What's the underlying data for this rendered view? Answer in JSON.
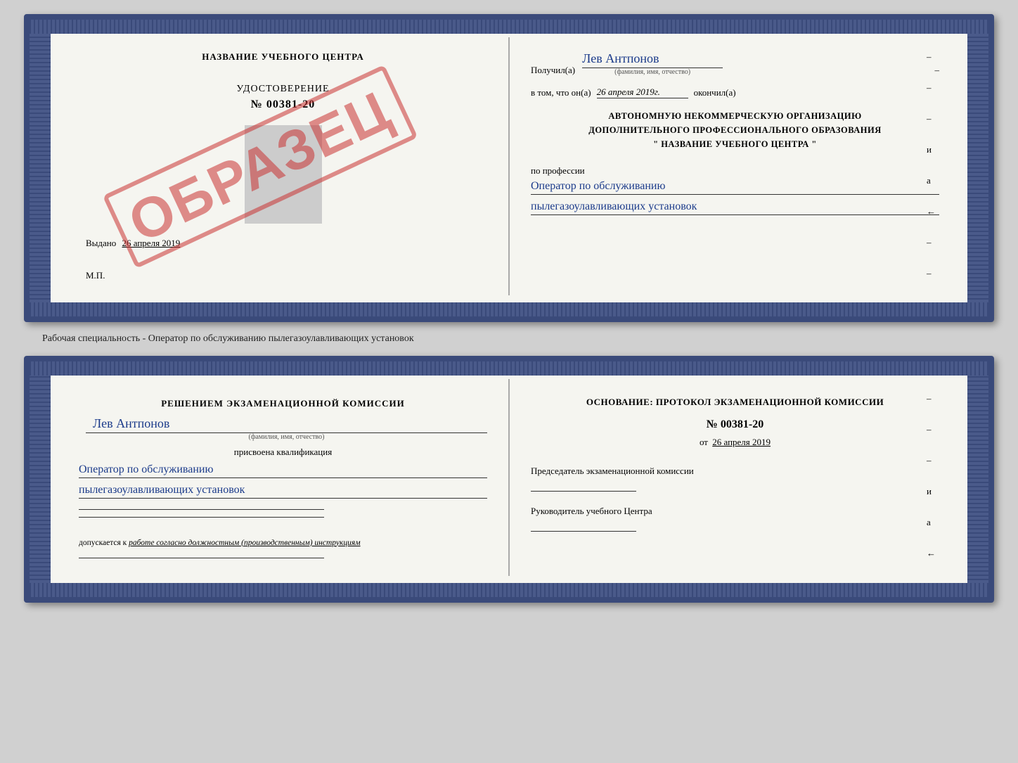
{
  "doc1": {
    "left": {
      "title": "НАЗВАНИЕ УЧЕБНОГО ЦЕНТРА",
      "stamp": "ОБРАЗЕЦ",
      "udostoverenie": "УДОСТОВЕРЕНИЕ",
      "number": "№ 00381-20",
      "vydano_label": "Выдано",
      "vydano_date": "26 апреля 2019",
      "mp": "М.П."
    },
    "right": {
      "poluchil_label": "Получил(а)",
      "person_name": "Лев Антпонов",
      "fio_label": "(фамилия, имя, отчество)",
      "vtom_label": "в том, что он(а)",
      "date_value": "26 апреля 2019г.",
      "okonchil": "окончил(а)",
      "org_line1": "АВТОНОМНУЮ НЕКОММЕРЧЕСКУЮ ОРГАНИЗАЦИЮ",
      "org_line2": "ДОПОЛНИТЕЛЬНОГО ПРОФЕССИОНАЛЬНОГО ОБРАЗОВАНИЯ",
      "org_line3": "\"  НАЗВАНИЕ УЧЕБНОГО ЦЕНТРА  \"",
      "po_professii": "по профессии",
      "profession1": "Оператор по обслуживанию",
      "profession2": "пылегазоулавливающих установок",
      "dashes": [
        "-",
        "-",
        "-",
        "и",
        "а",
        "←",
        "-",
        "-",
        "-",
        "-",
        "-",
        "-"
      ]
    }
  },
  "between_label": "Рабочая специальность - Оператор по обслуживанию пылегазоулавливающих установок",
  "doc2": {
    "left": {
      "resheniem": "Решением экзаменационной комиссии",
      "person_name": "Лев Антпонов",
      "fio_label": "(фамилия, имя, отчество)",
      "prisvoena": "присвоена квалификация",
      "qualification1": "Оператор по обслуживанию",
      "qualification2": "пылегазоулавливающих установок",
      "dopuskaetsya": "допускается к",
      "dopusk_text": "работе согласно должностным (производственным) инструкциям"
    },
    "right": {
      "osnovaniye": "Основание: протокол экзаменационной комиссии",
      "number": "№  00381-20",
      "ot_label": "от",
      "ot_date": "26 апреля 2019",
      "chairman_label": "Председатель экзаменационной комиссии",
      "rukovoditel_label": "Руководитель учебного Центра",
      "dashes": [
        "-",
        "-",
        "-",
        "и",
        "а",
        "←",
        "-",
        "-",
        "-",
        "-",
        "-",
        "-"
      ]
    }
  }
}
